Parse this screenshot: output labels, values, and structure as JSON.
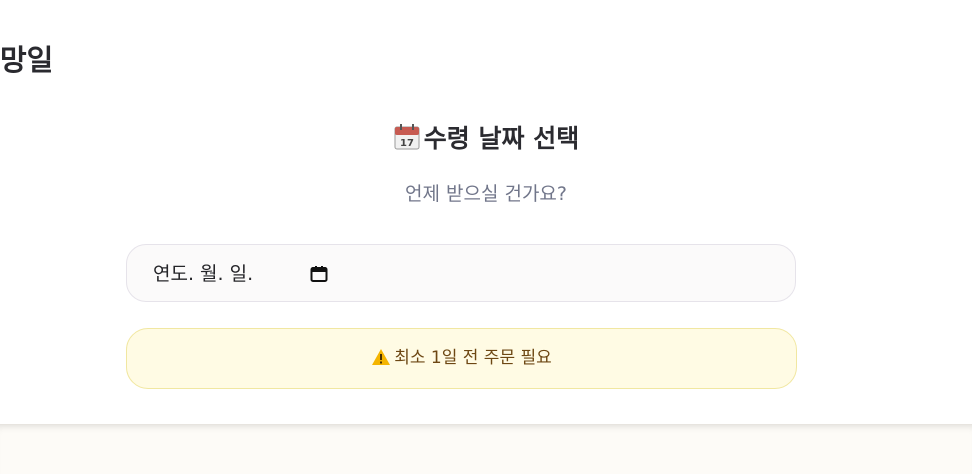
{
  "page": {
    "title": "망일"
  },
  "section": {
    "icon": "calendar-icon",
    "title": "수령 날짜 선택",
    "subtitle": "언제 받으실 건가요?"
  },
  "date_input": {
    "placeholder": "연도. 월. 일.",
    "icon": "calendar-picker-icon"
  },
  "notice": {
    "icon": "warning-icon",
    "text": "최소 1일 전 주문 필요"
  }
}
